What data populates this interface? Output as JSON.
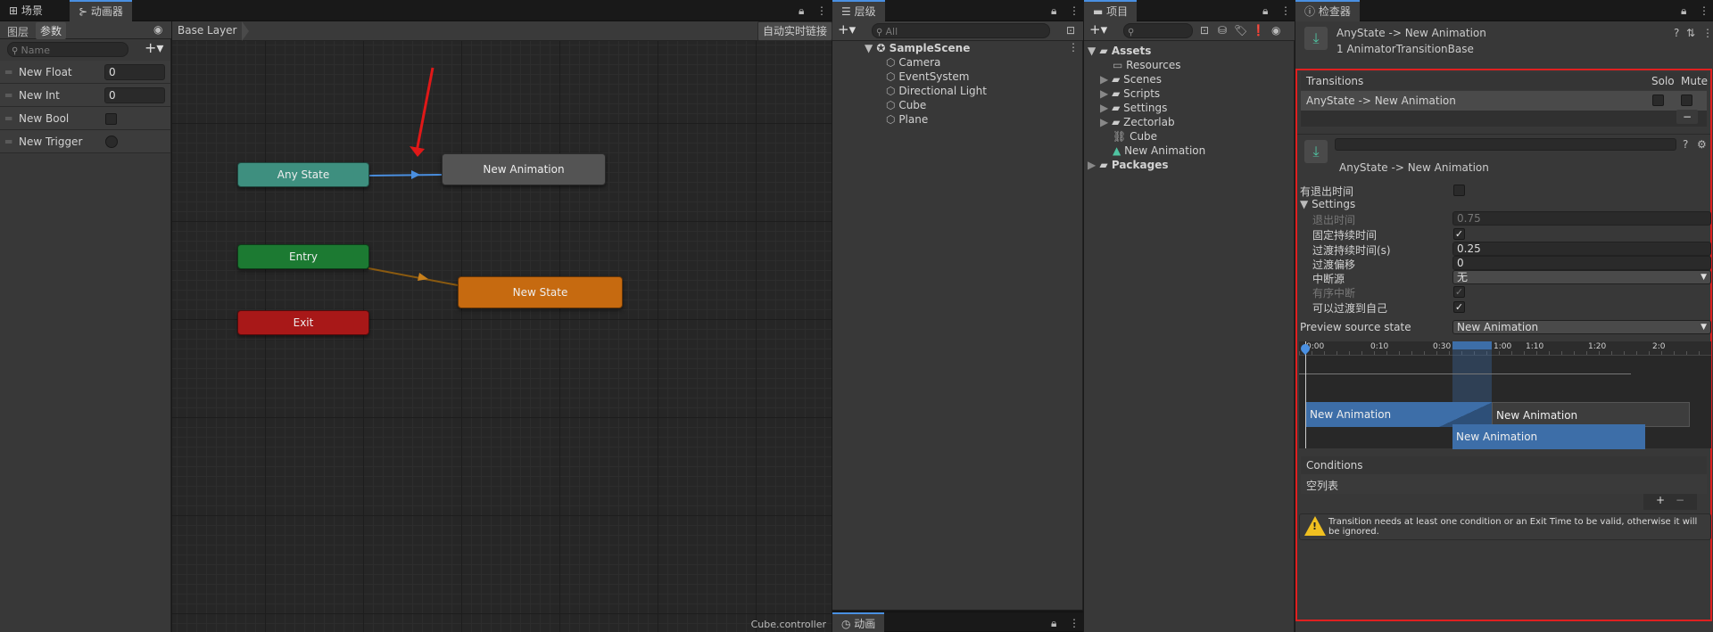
{
  "colors": {
    "accent": "#4a90e2",
    "any_state": "#3e8f7f",
    "entry": "#1c7a32",
    "exit": "#a81818",
    "default_state": "#c66a10",
    "selection_outline": "#e02020",
    "tl_blue": "#3d6ea8"
  },
  "tabs": {
    "scene": "场景",
    "animator": "动画器",
    "hierarchy": "层级",
    "project": "项目",
    "inspector": "检查器",
    "animation": "动画"
  },
  "animator": {
    "layers_tab": "图层",
    "params_tab": "参数",
    "search_placeholder": "Name",
    "breadcrumb": "Base Layer",
    "auto_live_link": "自动实时链接",
    "footer": "Cube.controller",
    "params": [
      {
        "name": "New Float",
        "value": "0"
      },
      {
        "name": "New Int",
        "value": "0"
      },
      {
        "name": "New Bool",
        "value": ""
      },
      {
        "name": "New Trigger",
        "value": ""
      }
    ],
    "nodes": {
      "any_state": "Any State",
      "new_animation": "New Animation",
      "entry": "Entry",
      "new_state": "New State",
      "exit": "Exit"
    }
  },
  "hierarchy": {
    "search_placeholder": "All",
    "scene": "SampleScene",
    "items": [
      "Camera",
      "EventSystem",
      "Directional Light",
      "Cube",
      "Plane"
    ]
  },
  "project": {
    "assets": "Assets",
    "folders": [
      "Resources",
      "Scenes",
      "Scripts",
      "Settings",
      "Zectorlab"
    ],
    "files": [
      "Cube",
      "New Animation"
    ],
    "packages": "Packages"
  },
  "inspector": {
    "title": "AnyState -> New Animation",
    "subtitle": "1 AnimatorTransitionBase",
    "transitions_header": "Transitions",
    "solo": "Solo",
    "mute": "Mute",
    "transition_item": "AnyState -> New Animation",
    "minus": "−",
    "plus": "+",
    "transition_name": "AnyState -> New Animation",
    "has_exit_time": "有退出时间",
    "settings": "Settings",
    "exit_time_label": "退出时间",
    "exit_time_value": "0.75",
    "fixed_duration_label": "固定持续时间",
    "duration_label": "过渡持续时间(s)",
    "duration_value": "0.25",
    "offset_label": "过渡偏移",
    "offset_value": "0",
    "interruption_label": "中断源",
    "interruption_value": "无",
    "ordered_label": "有序中断",
    "can_self_label": "可以过渡到自己",
    "preview_label": "Preview source state",
    "preview_value": "New Animation",
    "ruler": [
      "0:00",
      "0:10",
      "0:30",
      "1:00",
      "1:10",
      "1:20",
      "2:0"
    ],
    "clip_a": "New Animation",
    "clip_b": "New Animation",
    "clip_c": "New Animation",
    "conditions": "Conditions",
    "empty_list": "空列表",
    "warning": "Transition needs at least one condition or an Exit Time to be valid, otherwise it will be ignored."
  }
}
